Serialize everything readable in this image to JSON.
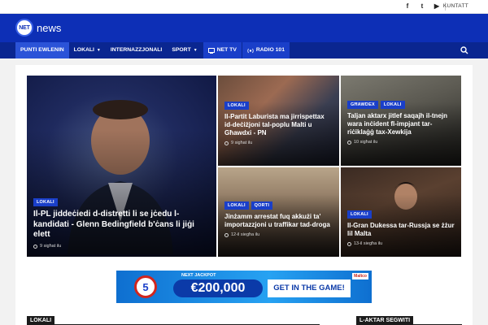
{
  "topbar": {
    "social_icons": [
      "facebook-icon",
      "twitter-icon",
      "youtube-icon"
    ],
    "contact_label": "KUNTATT"
  },
  "header": {
    "logo_mark": "NET",
    "logo_text": "news",
    "brand_color": "#0d2fb6"
  },
  "nav": {
    "items": [
      {
        "label": "PUNTI EWLENIN",
        "active": true
      },
      {
        "label": "LOKALI",
        "dropdown": true
      },
      {
        "label": "INTERNAZZJONALI"
      },
      {
        "label": "SPORT",
        "dropdown": true
      }
    ],
    "net_tv": "NET TV",
    "radio": "RADIO 101",
    "search_icon": "search-icon"
  },
  "featured": [
    {
      "tags": [
        "LOKALI"
      ],
      "headline": "Il-PL jiddeċiedi d-distretti li se jċedu l-kandidati - Glenn Bedingfield b'ċans li jiġi elett",
      "time": "9 sigħat ilu"
    },
    {
      "tags": [
        "LOKALI"
      ],
      "headline": "Il-Partit Laburista ma jirrispettax id-deċiżjoni tal-poplu Malti u Għawdxi - PN",
      "time": "9 sigħat ilu"
    },
    {
      "tags": [
        "GĦAWDEX",
        "LOKALI"
      ],
      "headline": "Taljan aktarx jitlef saqajh il-tnejn wara inċident fl-impjant tar-riċiklaġġ tax-Xewkija",
      "time": "10 sigħat ilu"
    },
    {
      "tags": [
        "LOKALI",
        "QORTI"
      ],
      "headline": "Jinżamm arrestat fuq akkużi ta' importazzjoni u traffikar tad-droga",
      "time": "12-il siegħa ilu"
    },
    {
      "tags": [
        "LOKALI"
      ],
      "headline": "Il-Gran Dukessa tar-Russja se żżur lil Malta",
      "time": "13-il siegħa ilu"
    }
  ],
  "ad": {
    "game_number": "5",
    "jackpot_label": "NEXT JACKPOT",
    "amount": "€200,000",
    "cta": "GET IN THE GAME!",
    "brand": "Maltco"
  },
  "sections": {
    "left": "LOKALI",
    "right": "L-AKTAR SEGWITI"
  }
}
